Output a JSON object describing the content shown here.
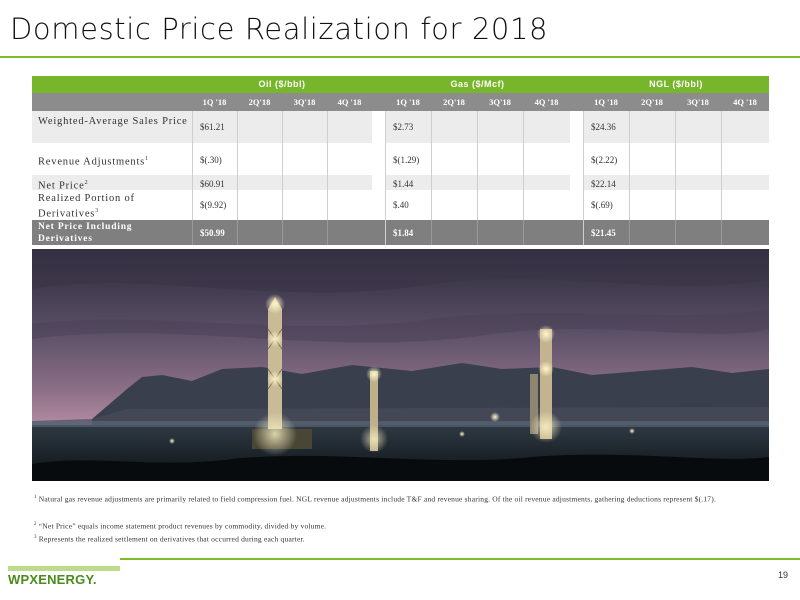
{
  "title": "Domestic Price Realization for 2018",
  "table": {
    "groups": [
      "Oil ($/bbl)",
      "Gas ($/Mcf)",
      "NGL ($/bbl)"
    ],
    "quarters": [
      "1Q '18",
      "2Q'18",
      "3Q'18",
      "4Q '18",
      "1Q '18",
      "2Q'18",
      "3Q'18",
      "4Q '18",
      "1Q '18",
      "2Q'18",
      "3Q'18",
      "4Q '18"
    ],
    "rows": [
      {
        "label": "Weighted-Average Sales Price",
        "oil": "$61.21",
        "gas": "$2.73",
        "ngl": "$24.36"
      },
      {
        "label": "Revenue Adjustments",
        "sup": "1",
        "oil": "$(.30)",
        "gas": "$(1.29)",
        "ngl": "$(2.22)"
      },
      {
        "label": "Net Price",
        "sup": "2",
        "oil": "$60.91",
        "gas": "$1.44",
        "ngl": "$22.14"
      },
      {
        "label": "Realized Portion of Derivatives",
        "sup": "3",
        "oil": "$(9.92)",
        "gas": "$.40",
        "ngl": "$(.69)"
      },
      {
        "label": "Net Price Including Derivatives",
        "oil": "$50.99",
        "gas": "$1.84",
        "ngl": "$21.45"
      }
    ]
  },
  "footnotes": {
    "f1": "Natural gas revenue adjustments are primarily related to field compression fuel. NGL revenue adjustments include T&F and revenue sharing. Of the oil revenue adjustments, gathering deductions represent $(.17).",
    "f2": "“Net Price” equals income statement product revenues by commodity, divided by volume.",
    "f3": "Represents the realized settlement on derivatives that occurred during each quarter."
  },
  "footer": {
    "logo": "WPXENERGY.",
    "page_number": "19"
  },
  "colors": {
    "accent_green": "#77b62a",
    "header_gray": "#8c8c8c",
    "row_shade": "#ececec",
    "total_row": "#7f7f7f"
  }
}
